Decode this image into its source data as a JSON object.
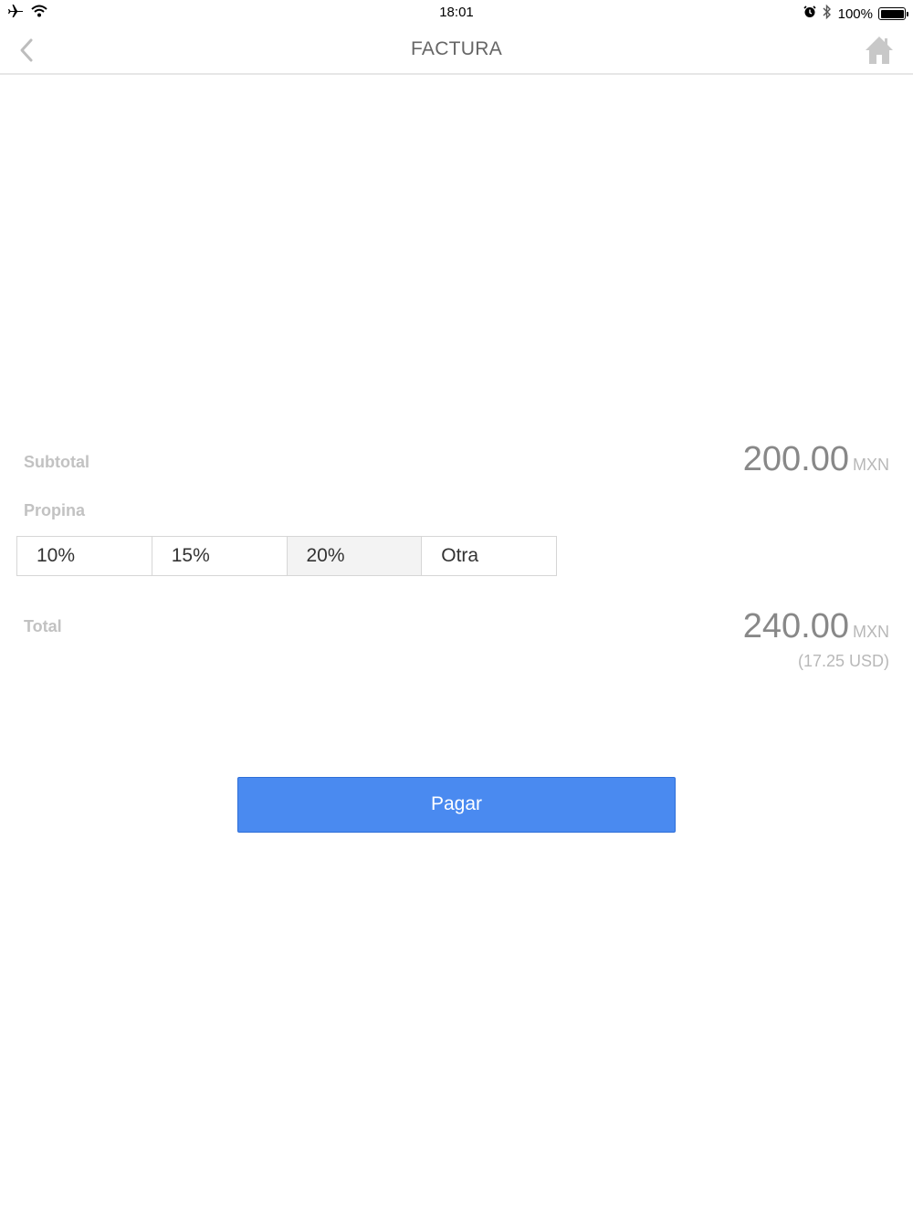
{
  "status_bar": {
    "time": "18:01",
    "battery_text": "100%",
    "battery_level": 1.0,
    "icons": [
      "airplane-icon",
      "wifi-icon",
      "alarm-icon",
      "bluetooth-icon",
      "battery-icon"
    ]
  },
  "nav": {
    "title": "FACTURA",
    "back_icon": "chevron-left-icon",
    "home_icon": "home-icon"
  },
  "subtotal": {
    "label": "Subtotal",
    "amount": "200.00",
    "currency": "MXN"
  },
  "tip": {
    "label": "Propina",
    "options": [
      "10%",
      "15%",
      "20%",
      "Otra"
    ],
    "selected_index": 2
  },
  "total": {
    "label": "Total",
    "amount": "240.00",
    "currency": "MXN",
    "converted": "(17.25 USD)"
  },
  "pay_button": {
    "label": "Pagar"
  },
  "colors": {
    "accent": "#4a8af0",
    "label_gray": "#c2c2c2",
    "amount_gray": "#888888",
    "selected_segment_bg": "#f3f3f3"
  }
}
